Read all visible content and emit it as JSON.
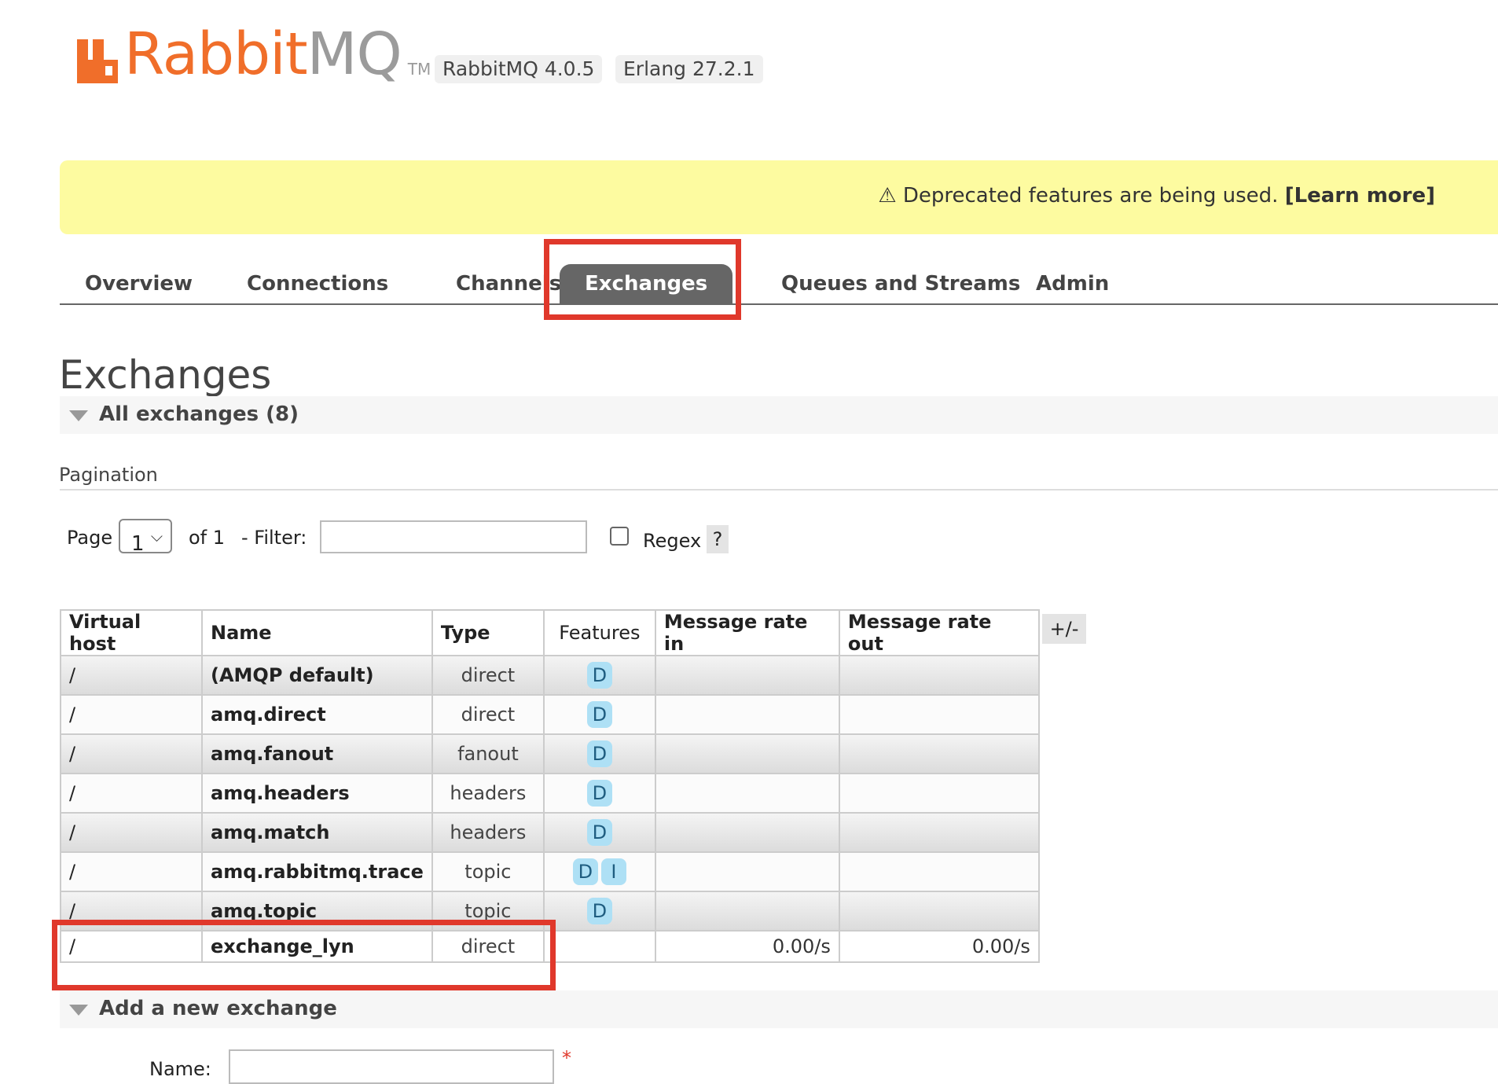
{
  "brand": {
    "name_part1": "Rabbit",
    "name_part2": "MQ",
    "tm": "TM"
  },
  "versions": [
    "RabbitMQ 4.0.5",
    "Erlang 27.2.1"
  ],
  "banner": {
    "icon": "⚠",
    "text": "Deprecated features are being used.",
    "link": "[Learn more]"
  },
  "tabs": [
    {
      "label": "Overview"
    },
    {
      "label": "Connections"
    },
    {
      "label": "Channels"
    },
    {
      "label": "Exchanges",
      "active": true
    },
    {
      "label": "Queues and Streams"
    },
    {
      "label": "Admin"
    }
  ],
  "page_title": "Exchanges",
  "section_all": "All exchanges (8)",
  "pagination": {
    "label": "Pagination",
    "page_label": "Page",
    "page_value": "1",
    "of_label": "of 1",
    "filter_label": "- Filter:",
    "filter_value": "",
    "regex_label": "Regex",
    "help": "?"
  },
  "table": {
    "headers": [
      "Virtual host",
      "Name",
      "Type",
      "Features",
      "Message rate in",
      "Message rate out"
    ],
    "toggle_columns": "+/-",
    "rows": [
      {
        "vhost": "/",
        "name": "(AMQP default)",
        "type": "direct",
        "features": [
          "D"
        ],
        "rate_in": "",
        "rate_out": ""
      },
      {
        "vhost": "/",
        "name": "amq.direct",
        "type": "direct",
        "features": [
          "D"
        ],
        "rate_in": "",
        "rate_out": ""
      },
      {
        "vhost": "/",
        "name": "amq.fanout",
        "type": "fanout",
        "features": [
          "D"
        ],
        "rate_in": "",
        "rate_out": ""
      },
      {
        "vhost": "/",
        "name": "amq.headers",
        "type": "headers",
        "features": [
          "D"
        ],
        "rate_in": "",
        "rate_out": ""
      },
      {
        "vhost": "/",
        "name": "amq.match",
        "type": "headers",
        "features": [
          "D"
        ],
        "rate_in": "",
        "rate_out": ""
      },
      {
        "vhost": "/",
        "name": "amq.rabbitmq.trace",
        "type": "topic",
        "features": [
          "D",
          "I"
        ],
        "rate_in": "",
        "rate_out": ""
      },
      {
        "vhost": "/",
        "name": "amq.topic",
        "type": "topic",
        "features": [
          "D"
        ],
        "rate_in": "",
        "rate_out": ""
      },
      {
        "vhost": "/",
        "name": "exchange_lyn",
        "type": "direct",
        "features": [],
        "rate_in": "0.00/s",
        "rate_out": "0.00/s"
      }
    ]
  },
  "section_add": "Add a new exchange",
  "form": {
    "name_label": "Name:",
    "required_mark": "*"
  },
  "colors": {
    "brand_orange": "#f06e2a",
    "banner_yellow": "#fdfba0",
    "highlight_red": "#e0382b",
    "badge_blue": "#aee0f5"
  }
}
